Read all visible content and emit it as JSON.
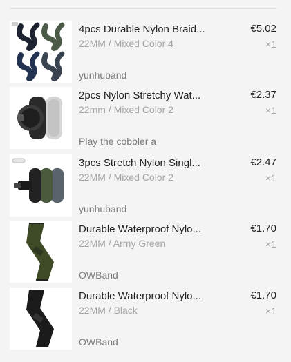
{
  "items": [
    {
      "title": "4pcs Durable Nylon Braid...",
      "variant": "22MM / Mixed Color 4",
      "store": "yunhuband",
      "price": "€5.02",
      "qty": "×1",
      "image": "four-braided-nylon-watch-straps"
    },
    {
      "title": "2pcs Nylon Stretchy Wat...",
      "variant": "22mm / Mixed Color 2",
      "store": "Play the cobbler a",
      "price": "€2.37",
      "qty": "×1",
      "image": "black-and-grey-stretchy-watch-bands"
    },
    {
      "title": "3pcs Stretch Nylon Singl...",
      "variant": "22MM / Mixed Color 2",
      "store": "yunhuband",
      "price": "€2.47",
      "qty": "×1",
      "image": "three-stretch-nylon-watch-bands"
    },
    {
      "title": "Durable Waterproof Nylo...",
      "variant": "22MM / Army Green",
      "store": "OWBand",
      "price": "€1.70",
      "qty": "×1",
      "image": "army-green-nylon-strap"
    },
    {
      "title": "Durable Waterproof Nylo...",
      "variant": "22MM / Black",
      "store": "OWBand",
      "price": "€1.70",
      "qty": "×1",
      "image": "black-nylon-strap"
    }
  ]
}
